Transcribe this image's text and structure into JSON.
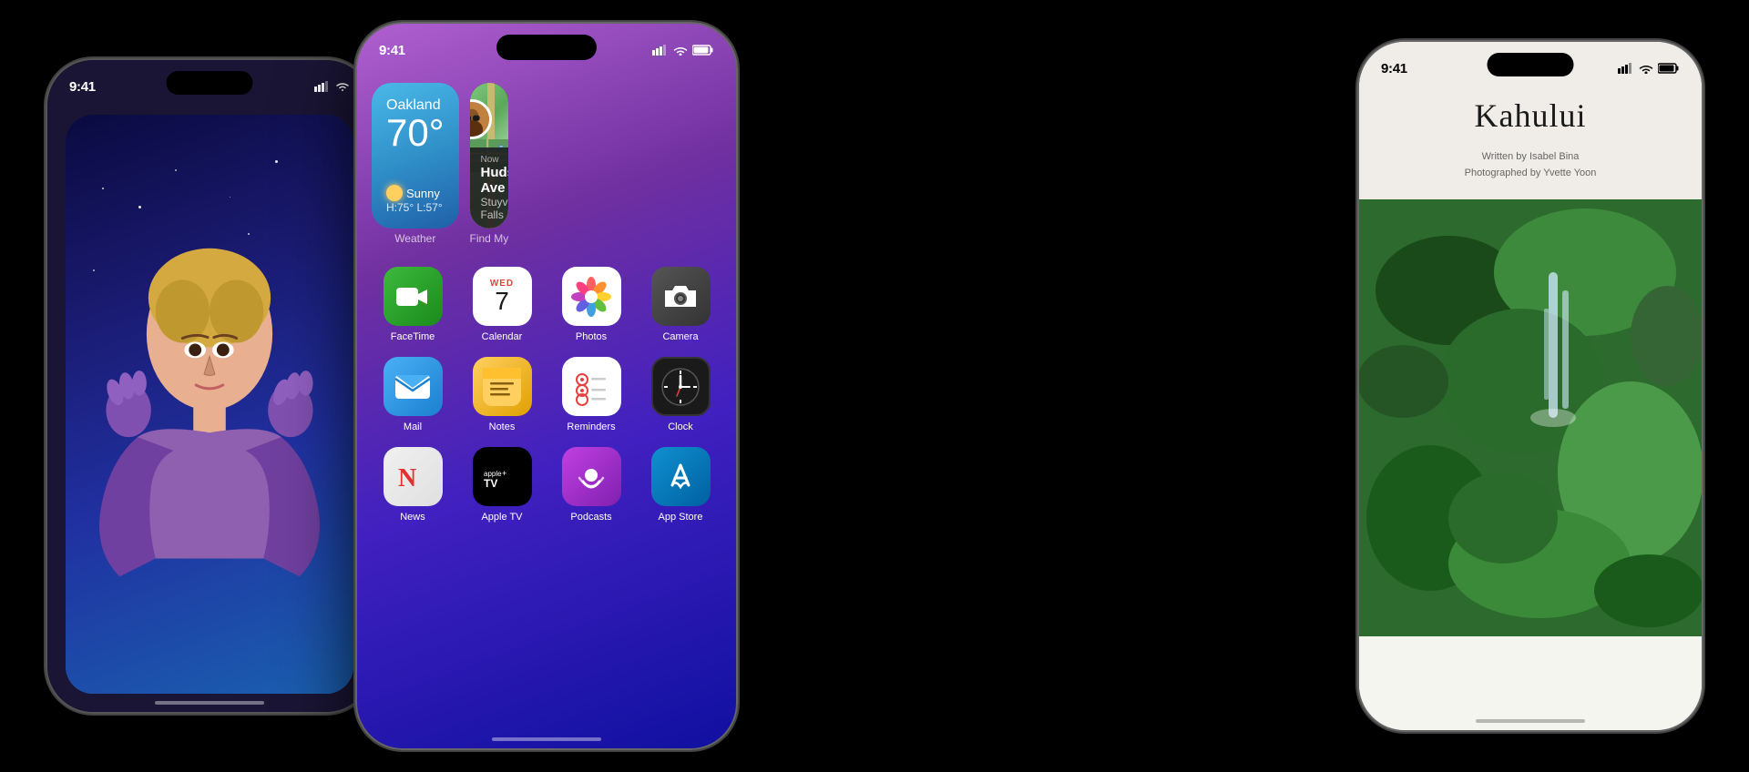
{
  "page": {
    "background": "#000"
  },
  "phone_left": {
    "time": "9:41",
    "signal_bars": "▲▲▲",
    "wifi": "wifi",
    "portrait": {
      "alt": "Artistic portrait of person with purple gloves"
    }
  },
  "phone_center": {
    "time": "9:41",
    "signal_bars": "▲▲▲",
    "wifi": "wifi",
    "battery": "battery",
    "weather_widget": {
      "city": "Oakland",
      "temp": "70°",
      "condition": "Sunny",
      "high_low": "H:75° L:57°",
      "label": "Weather"
    },
    "findmy_widget": {
      "now": "Now",
      "street": "Hudson Ave",
      "city": "Stuyvesant Falls",
      "label": "Find My"
    },
    "apps": [
      {
        "id": "facetime",
        "label": "FaceTime",
        "icon_type": "facetime"
      },
      {
        "id": "calendar",
        "label": "Calendar",
        "icon_type": "calendar",
        "day": "7",
        "dow": "WED"
      },
      {
        "id": "photos",
        "label": "Photos",
        "icon_type": "photos"
      },
      {
        "id": "camera",
        "label": "Camera",
        "icon_type": "camera"
      },
      {
        "id": "mail",
        "label": "Mail",
        "icon_type": "mail"
      },
      {
        "id": "notes",
        "label": "Notes",
        "icon_type": "notes"
      },
      {
        "id": "reminders",
        "label": "Reminders",
        "icon_type": "reminders"
      },
      {
        "id": "clock",
        "label": "Clock",
        "icon_type": "clock"
      },
      {
        "id": "news",
        "label": "News",
        "icon_type": "news"
      },
      {
        "id": "appletv",
        "label": "Apple TV",
        "icon_type": "appletv"
      },
      {
        "id": "podcasts",
        "label": "Podcasts",
        "icon_type": "podcasts"
      },
      {
        "id": "appstore",
        "label": "App Store",
        "icon_type": "appstore"
      }
    ]
  },
  "phone_right": {
    "time": "9:41",
    "signal_bars": "▲▲▲",
    "wifi": "wifi",
    "battery": "battery",
    "book": {
      "title": "Kahului",
      "written_by": "Written by Isabel Bina",
      "photographed_by": "Photographed by Yvette Yoon"
    }
  }
}
